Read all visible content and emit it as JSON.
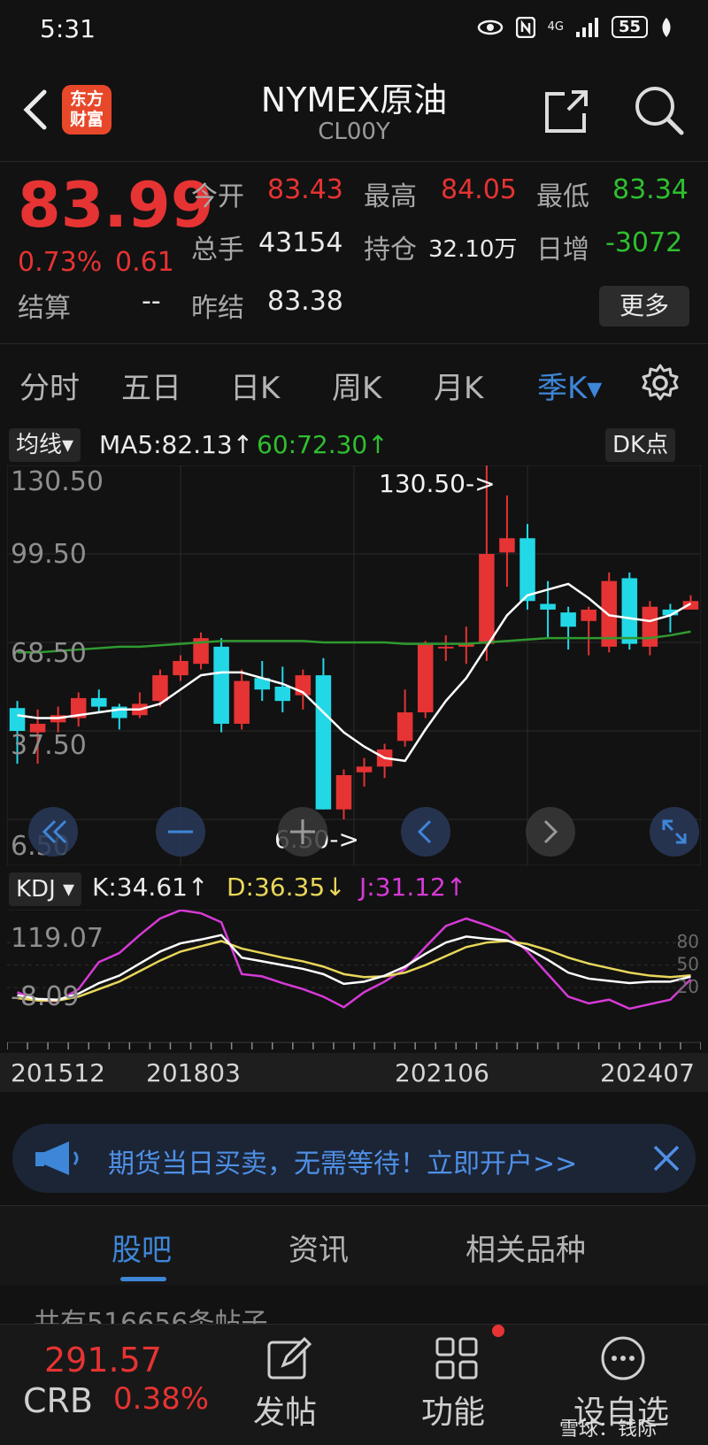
{
  "status": {
    "time": "5:31",
    "network": "4G",
    "battery": "55"
  },
  "nav": {
    "logo_line1": "东方",
    "logo_line2": "财富",
    "title": "NYMEX原油",
    "code": "CL00Y"
  },
  "quote": {
    "price": "83.99",
    "change_pct": "0.73%",
    "change": "0.61",
    "open_label": "今开",
    "open": "83.43",
    "high_label": "最高",
    "high": "84.05",
    "low_label": "最低",
    "low": "83.34",
    "volume_label": "总手",
    "volume": "43154",
    "oi_label": "持仓",
    "oi": "32.10万",
    "daily_inc_label": "日增",
    "daily_inc": "-3072",
    "settle_label": "结算",
    "settle": "--",
    "prev_settle_label": "昨结",
    "prev_settle": "83.38",
    "more": "更多"
  },
  "tabs": [
    {
      "label": "分时"
    },
    {
      "label": "五日"
    },
    {
      "label": "日K"
    },
    {
      "label": "周K"
    },
    {
      "label": "月K"
    },
    {
      "label": "季K▾"
    }
  ],
  "indicator": {
    "main_selector": "均线▾",
    "ma5": "MA5:82.13↑",
    "ma60": "60:72.30↑",
    "dk": "DK点",
    "kdj_selector": "KDJ ▾",
    "k": "K:34.61↑",
    "d": "D:36.35↓",
    "j": "J:31.12↑"
  },
  "colors": {
    "up": "#e63333",
    "down": "#22d8e6",
    "ma5": "#ffffff",
    "ma60": "#2f9a2f",
    "k": "#ffffff",
    "d": "#e8d75a",
    "j": "#d63ad6",
    "accent": "#3e86d8"
  },
  "chart_data": [
    {
      "type": "candlestick",
      "title": "",
      "ylim": [
        6.5,
        130.5
      ],
      "y_ticks": [
        "130.50",
        "99.50",
        "68.50",
        "37.50",
        "6.50"
      ],
      "max_marker": "130.50->",
      "min_marker": "6.50->",
      "candles": [
        {
          "o": 45.5,
          "c": 37.5,
          "h": 48,
          "l": 26
        },
        {
          "o": 37,
          "c": 40,
          "h": 45,
          "l": 26
        },
        {
          "o": 40.5,
          "c": 43,
          "h": 46,
          "l": 37
        },
        {
          "o": 42,
          "c": 49,
          "h": 51,
          "l": 39
        },
        {
          "o": 49,
          "c": 46,
          "h": 52,
          "l": 44
        },
        {
          "o": 46,
          "c": 42,
          "h": 47,
          "l": 38
        },
        {
          "o": 43,
          "c": 47,
          "h": 51,
          "l": 42
        },
        {
          "o": 48,
          "c": 57,
          "h": 59,
          "l": 46
        },
        {
          "o": 57,
          "c": 62,
          "h": 64,
          "l": 55
        },
        {
          "o": 61,
          "c": 70,
          "h": 72,
          "l": 59
        },
        {
          "o": 67,
          "c": 40,
          "h": 70,
          "l": 37
        },
        {
          "o": 40,
          "c": 55,
          "h": 59,
          "l": 38
        },
        {
          "o": 56,
          "c": 52,
          "h": 62,
          "l": 48
        },
        {
          "o": 53,
          "c": 48,
          "h": 60,
          "l": 44
        },
        {
          "o": 50,
          "c": 57,
          "h": 59,
          "l": 45
        },
        {
          "o": 57,
          "c": 10,
          "h": 63,
          "l": 10
        },
        {
          "o": 10,
          "c": 22,
          "h": 24,
          "l": 6.5
        },
        {
          "o": 23,
          "c": 25,
          "h": 28,
          "l": 18
        },
        {
          "o": 25,
          "c": 31,
          "h": 33,
          "l": 21
        },
        {
          "o": 34,
          "c": 44,
          "h": 52,
          "l": 32
        },
        {
          "o": 44,
          "c": 68,
          "h": 69,
          "l": 42
        },
        {
          "o": 67,
          "c": 67,
          "h": 71,
          "l": 62
        },
        {
          "o": 67,
          "c": 68,
          "h": 74,
          "l": 61
        },
        {
          "o": 68,
          "c": 99.5,
          "h": 130.5,
          "l": 62
        },
        {
          "o": 100,
          "c": 105,
          "h": 120,
          "l": 88
        },
        {
          "o": 105,
          "c": 83,
          "h": 110,
          "l": 80
        },
        {
          "o": 82,
          "c": 80,
          "h": 90,
          "l": 70
        },
        {
          "o": 79,
          "c": 74,
          "h": 81,
          "l": 66
        },
        {
          "o": 76,
          "c": 80,
          "h": 81,
          "l": 64
        },
        {
          "o": 67,
          "c": 90,
          "h": 93,
          "l": 65
        },
        {
          "o": 91,
          "c": 68,
          "h": 93,
          "l": 66
        },
        {
          "o": 67,
          "c": 81,
          "h": 83,
          "l": 64
        },
        {
          "o": 80,
          "c": 78,
          "h": 82,
          "l": 72
        },
        {
          "o": 80,
          "c": 83,
          "h": 85,
          "l": 81
        }
      ],
      "ma5": [
        43,
        42,
        42,
        43,
        44,
        45,
        45,
        47,
        52,
        57,
        58,
        58,
        56,
        54,
        51,
        44,
        37,
        32,
        28,
        27,
        38,
        48,
        56,
        67,
        78,
        85,
        87,
        89,
        84,
        78,
        77,
        76,
        78,
        82.13
      ],
      "ma60": [
        65,
        65,
        65.5,
        66,
        66.5,
        67,
        67,
        67.5,
        68,
        68.5,
        69,
        69,
        69,
        69,
        69,
        68.5,
        68.5,
        68.5,
        68.5,
        68,
        68,
        68,
        68,
        68.5,
        69,
        69.5,
        70,
        70,
        70,
        70,
        70,
        70,
        71,
        72.3
      ]
    },
    {
      "type": "line",
      "title": "KDJ",
      "ylim": [
        -8.09,
        119.07
      ],
      "y_ticks": [
        "119.07",
        "-8.09"
      ],
      "ref_lines": [
        "80",
        "50",
        "20"
      ],
      "series": [
        {
          "name": "K",
          "values": [
            10,
            5,
            4,
            12,
            26,
            36,
            52,
            68,
            79,
            84,
            90,
            60,
            55,
            50,
            45,
            38,
            25,
            28,
            36,
            48,
            65,
            80,
            88,
            85,
            83,
            72,
            57,
            40,
            32,
            29,
            26,
            28,
            28,
            34.61
          ]
        },
        {
          "name": "D",
          "values": [
            6,
            3,
            3,
            8,
            18,
            28,
            42,
            56,
            68,
            75,
            82,
            72,
            66,
            60,
            55,
            48,
            38,
            34,
            35,
            40,
            50,
            62,
            74,
            80,
            82,
            78,
            70,
            60,
            52,
            46,
            40,
            36,
            34,
            36.35
          ]
        },
        {
          "name": "J",
          "values": [
            14,
            3,
            2,
            18,
            54,
            66,
            90,
            112,
            123,
            119,
            107,
            38,
            35,
            26,
            18,
            8,
            -6,
            14,
            28,
            45,
            74,
            102,
            112,
            103,
            92,
            68,
            38,
            8,
            -1,
            4,
            -8,
            -2,
            4,
            31.12
          ]
        }
      ]
    }
  ],
  "x_axis": [
    "201512",
    "201803",
    "202106",
    "202407"
  ],
  "banner": {
    "text": "期货当日买卖，无需等待！立即开户>>"
  },
  "bottom_tabs": [
    {
      "label": "股吧"
    },
    {
      "label": "资讯"
    },
    {
      "label": "相关品种"
    }
  ],
  "post_count": "共有516656条帖子",
  "footer": {
    "crb_price": "291.57",
    "crb_name": "CRB",
    "crb_pct": "0.38%",
    "post_label": "发帖",
    "func_label": "功能",
    "self_select_label": "设自选",
    "watermark": "雪球：钱际"
  }
}
